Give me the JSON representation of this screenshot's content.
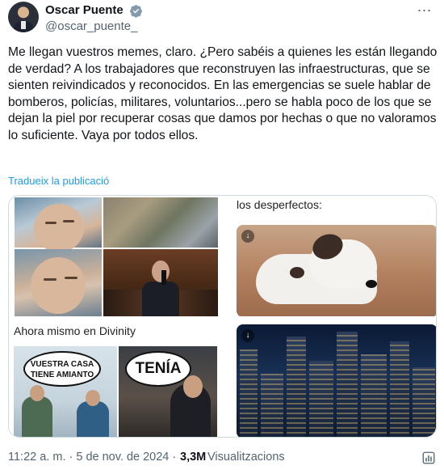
{
  "author": {
    "name": "Oscar Puente",
    "handle": "@oscar_puente_",
    "verified": true
  },
  "tweet": {
    "text": "Me llegan vuestros memes, claro. ¿Pero sabéis a quienes les están llegando de verdad? A los trabajadores que reconstruyen las infraestructuras, que se sienten reivindicados y reconocidos. En las emergencias se suele hablar de bomberos, policías, militares, voluntarios...pero se habla poco de los que se dejan la piel por recuperar cosas que damos por hechas o que no valoramos lo suficiente. Vaya por todos ellos.",
    "translate_link": "Tradueix la publicació"
  },
  "media": {
    "cell2_caption": "los desperfectos:",
    "cell3_caption": "Ahora mismo en Divinity",
    "bubble_left": "VUESTRA CASA TIENE AMIANTO",
    "bubble_right": "TENÍA"
  },
  "footer": {
    "time": "11:22 a. m. · 5 de nov. de 2024 ·",
    "views_count": "3,3M",
    "views_label": "Visualitzacions"
  },
  "icons": {
    "verified": "verified-badge-icon",
    "more": "more-options-icon",
    "download": "download-icon",
    "stats": "analytics-icon"
  },
  "colors": {
    "link": "#1d9bf0",
    "secondary_text": "#536471",
    "primary_text": "#0f1419"
  }
}
